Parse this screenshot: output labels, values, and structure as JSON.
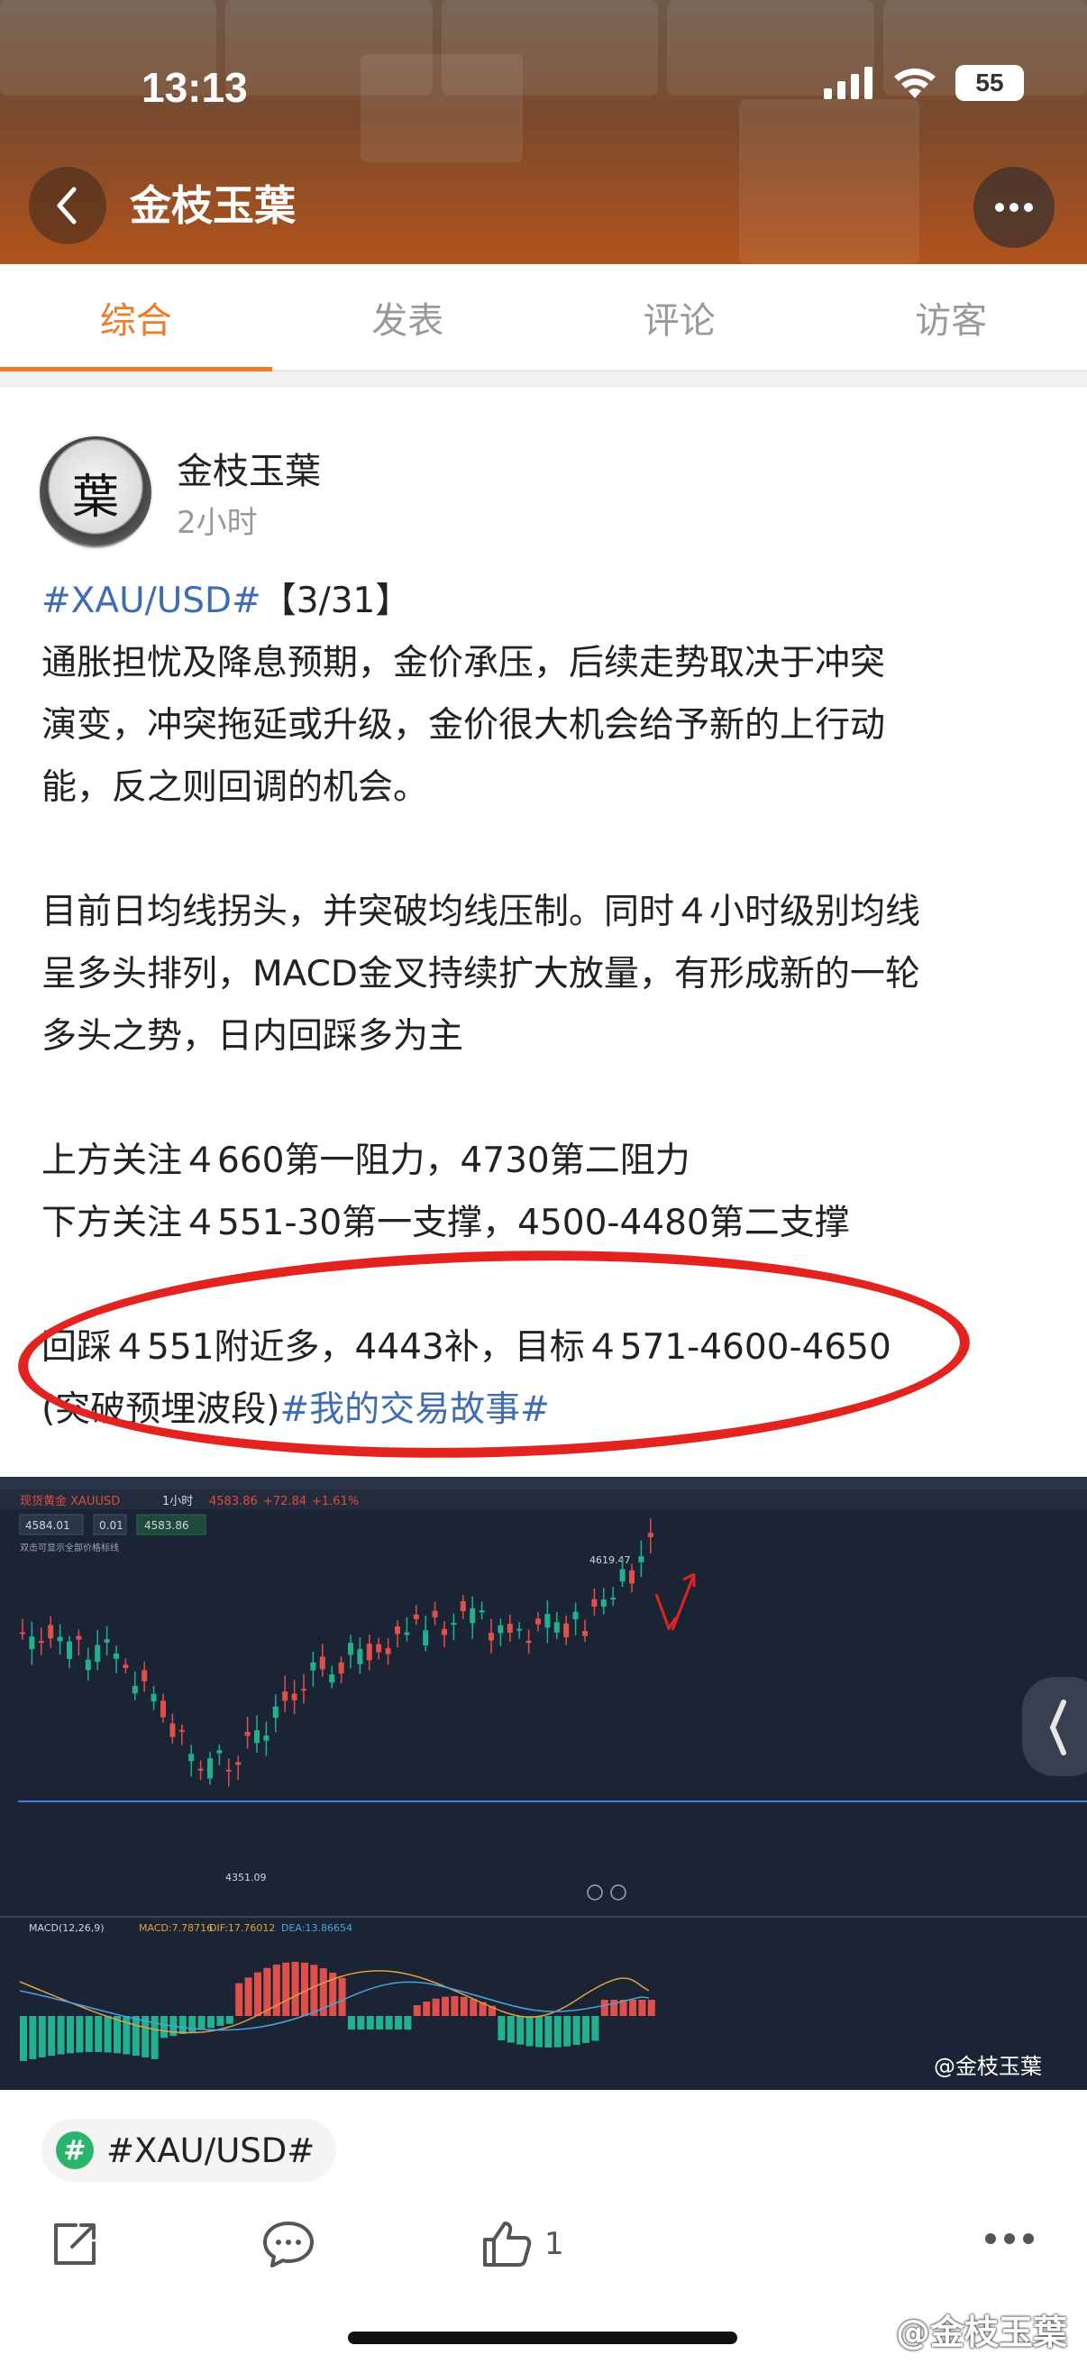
{
  "status_bar": {
    "time": "13:13",
    "battery": "55"
  },
  "header": {
    "title": "金枝玉葉"
  },
  "tabs": [
    {
      "label": "综合",
      "active": true
    },
    {
      "label": "发表",
      "active": false
    },
    {
      "label": "评论",
      "active": false
    },
    {
      "label": "访客",
      "active": false
    }
  ],
  "post": {
    "author": "金枝玉葉",
    "avatar_char": "葉",
    "time": "2小时",
    "tag_prefix": "#XAU/USD#",
    "date": "【3/31】",
    "lines_p1": [
      "通胀担忧及降息预期，金价承压，后续走势取决于冲突",
      "演变，冲突拖延或升级，金价很大机会给予新的上行动",
      "能，反之则回调的机会。"
    ],
    "lines_p2": [
      "目前日均线拐头，并突破均线压制。同时４小时级别均线",
      "呈多头排列，MACD金叉持续扩大放量，有形成新的一轮",
      "多头之势，日内回踩多为主"
    ],
    "lines_p3": [
      "上方关注４660第一阻力，4730第二阻力",
      "下方关注４551-30第一支撑，4500-4480第二支撑"
    ],
    "line_p4_1": "回踩４551附近多，4443补，目标４571-4600-4650",
    "line_p4_2": "(突破预埋波段)",
    "tag_suffix": "#我的交易故事#"
  },
  "chart": {
    "symbol": "现货黄金 XAUUSD",
    "period": "1小时",
    "price": "4583.86",
    "change": "+72.84",
    "change_pct": "+1.61%",
    "bid": "4584.01",
    "lot": "0.01",
    "ask": "4583.86",
    "hint": "双击可显示全部价格标线",
    "high_label": "4619.47",
    "low_label": "4351.09",
    "macd_label": "MACD(12,26,9)",
    "macd_value": "MACD:7.78716",
    "dif_value": "DIF:17.76012",
    "dea_value": "DEA:13.86654",
    "watermark": "@金枝玉葉"
  },
  "topic": "#XAU/USD#",
  "actions": {
    "like_count": "1"
  },
  "bottom_watermark": "@金枝玉葉",
  "colors": {
    "accent": "#ee7a2a",
    "link": "#3f6db5",
    "highlight_oval": "#e3231f",
    "topic_icon": "#2bb46b"
  }
}
